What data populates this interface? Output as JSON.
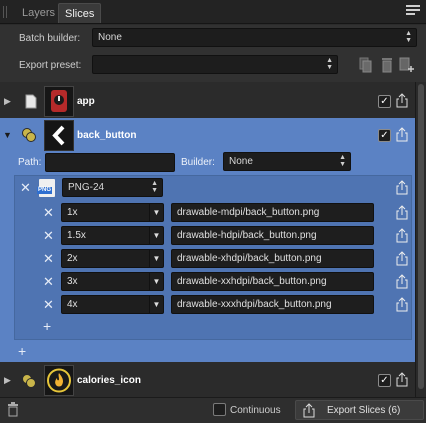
{
  "tabs": {
    "layers": "Layers",
    "slices": "Slices"
  },
  "options": {
    "batch_builder_label": "Batch builder:",
    "batch_builder_value": "None",
    "export_preset_label": "Export preset:",
    "export_preset_value": ""
  },
  "slices": [
    {
      "name": "app",
      "checked": "✓",
      "thumb_icon": "app-icon"
    },
    {
      "name": "back_button",
      "checked": "✓",
      "thumb_icon": "chevron-left-icon"
    },
    {
      "name": "calories_icon",
      "checked": "✓",
      "thumb_icon": "flame-icon"
    }
  ],
  "back_button": {
    "path_label": "Path:",
    "path_value": "",
    "builder_label": "Builder:",
    "builder_value": "None",
    "format": "PNG-24",
    "format_icon_text": "PNG",
    "exports": [
      {
        "scale": "1x",
        "path": "drawable-mdpi/back_button.png"
      },
      {
        "scale": "1.5x",
        "path": "drawable-hdpi/back_button.png"
      },
      {
        "scale": "2x",
        "path": "drawable-xhdpi/back_button.png"
      },
      {
        "scale": "3x",
        "path": "drawable-xxhdpi/back_button.png"
      },
      {
        "scale": "4x",
        "path": "drawable-xxxhdpi/back_button.png"
      }
    ]
  },
  "bottom": {
    "continuous_label": "Continuous",
    "export_button": "Export Slices (6)"
  },
  "colors": {
    "selected_row": "#5b82c4",
    "inner_panel": "#4f74b2",
    "panel_bg": "#2b2b2b"
  }
}
